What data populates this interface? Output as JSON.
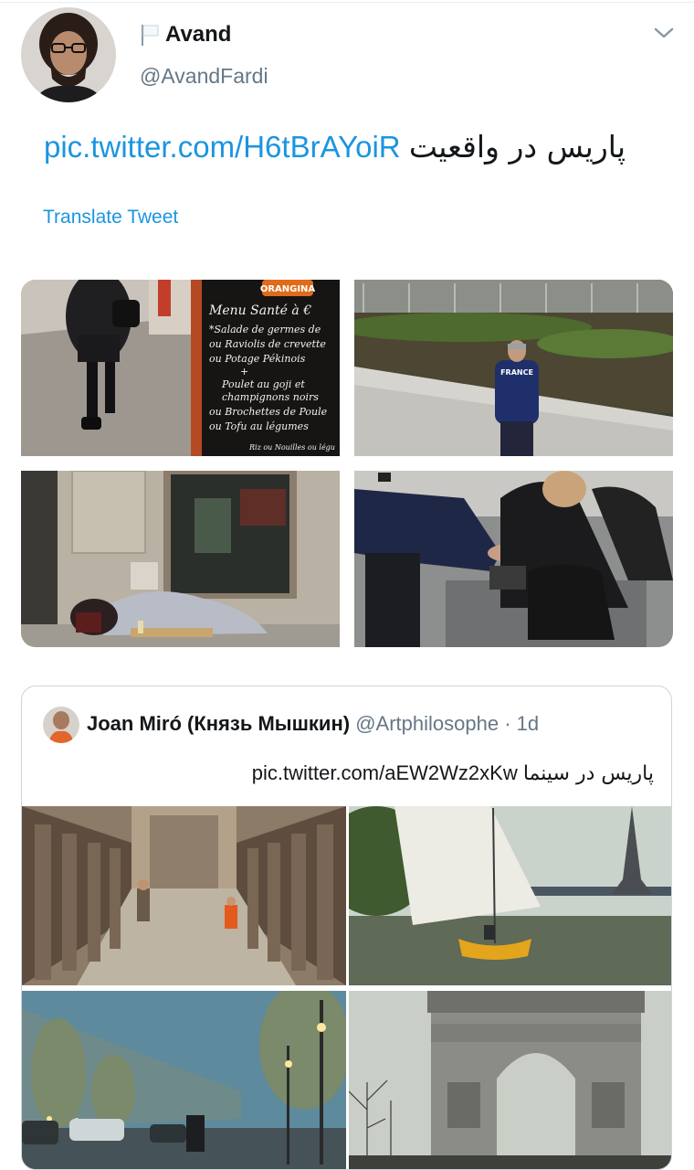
{
  "tweet": {
    "display_name": "Avand",
    "handle": "@AvandFardi",
    "text_persian": "پاریس در واقعیت",
    "text_link": "pic.twitter.com/H6tBrAYoiR",
    "translate_label": "Translate Tweet"
  },
  "photos": {
    "menu_sign": {
      "brand": "ORANGINA",
      "lines": [
        "Menu Santé à €",
        "*Salade de germes de",
        "ou Raviolis de crevette",
        "ou Potage Pékinois",
        "+",
        "Poulet au goji et",
        "champignons noirs",
        "ou Brochettes de Poule",
        "ou Tofu au légumes",
        "Riz ou Nouilles ou légu"
      ]
    },
    "jacket_text": "FRANCE"
  },
  "quoted_tweet": {
    "display_name": "Joan Miró (Князь Мышкин)",
    "handle": "@Artphilosophe",
    "separator": "·",
    "time": "1d",
    "text_persian": "پاریس در سینما",
    "text_link": "pic.twitter.com/aEW2Wz2xKw"
  },
  "icons": {
    "flag": "flag-icon",
    "menu_caret": "chevron-down-icon"
  }
}
